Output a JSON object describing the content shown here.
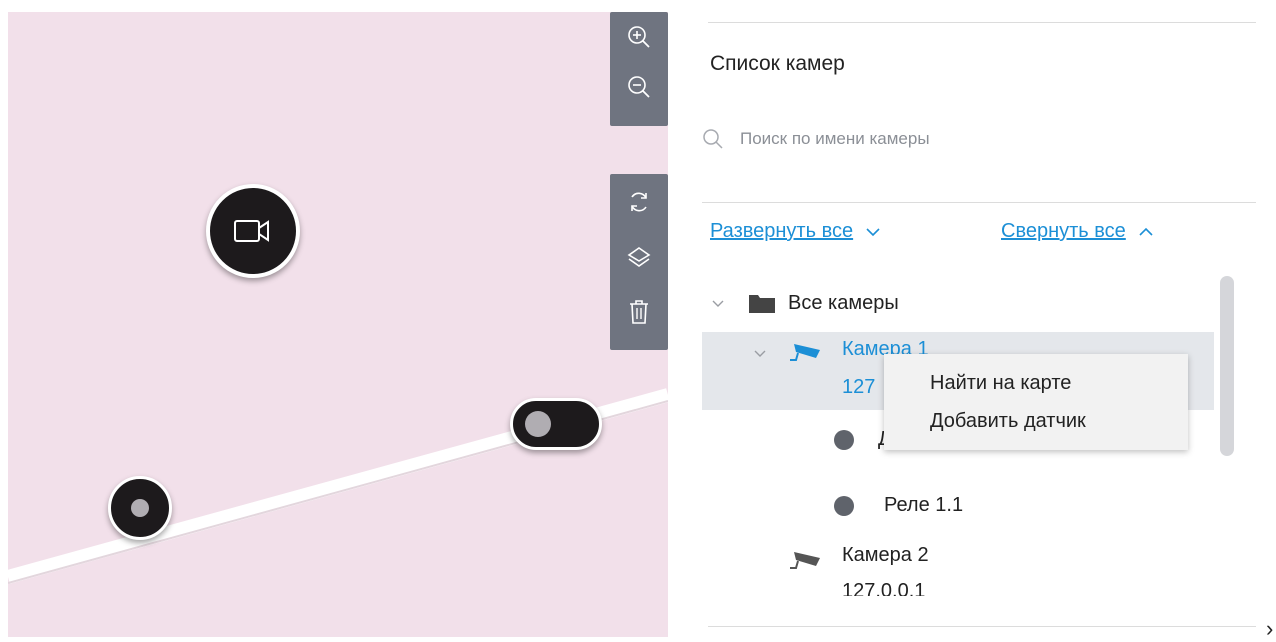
{
  "map": {
    "zoom_in_icon": "zoom-in-icon",
    "zoom_out_icon": "zoom-out-icon",
    "refresh_icon": "refresh-icon",
    "layers_icon": "layers-icon",
    "delete_icon": "trash-icon",
    "background_color": "#f2e0ea",
    "marker_color": "#1d1a1c"
  },
  "panel": {
    "title": "Список камер",
    "search_placeholder": "Поиск по имени камеры",
    "expand_all": "Развернуть все",
    "collapse_all": "Свернуть все"
  },
  "tree": {
    "root": "Все камеры",
    "camera1": {
      "name": "Камера 1",
      "address_visible": "127"
    },
    "sensor_partial": "Д",
    "relay": "Реле 1.1",
    "camera2": {
      "name": "Камера 2",
      "address": "127.0.0.1"
    }
  },
  "context_menu": {
    "items": [
      "Найти на карте",
      "Добавить датчик"
    ]
  },
  "edge_glyph": "›",
  "colors": {
    "accent": "#1c8fd6",
    "toolbar": "#6f7480",
    "selection": "#e4e7eb"
  }
}
